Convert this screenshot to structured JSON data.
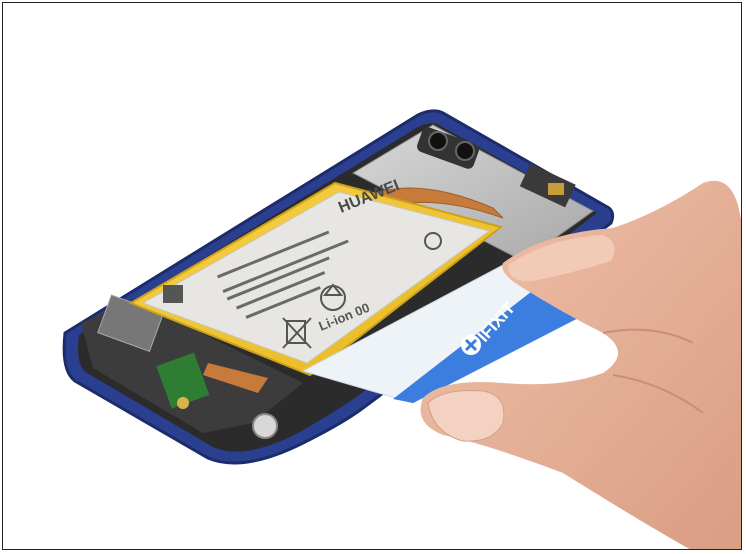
{
  "photo": {
    "subject": "phone-battery-removal",
    "battery_brand": "HUAWEI",
    "battery_chemistry": "Li-ion 00",
    "tool_brand": "iFixit",
    "tool_label": "IFIXIT"
  },
  "colors": {
    "background": "#ffffff",
    "frame_blue": "#2a3f8f",
    "battery_yellow": "#f3c22b",
    "battery_label": "#e8e6e2",
    "card_blue": "#3b7ee0",
    "card_white": "#eef3f8",
    "board_metal": "#c9c9c9",
    "copper_flex": "#c77b3b",
    "skin": "#e7b299"
  },
  "icons": {
    "tool_logo": "ifixit-logo-icon",
    "recycle": "recycle-icon",
    "bin": "crossed-bin-icon"
  }
}
